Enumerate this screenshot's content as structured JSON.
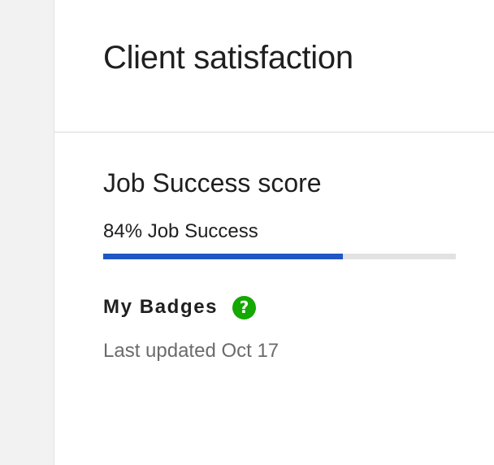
{
  "header": {
    "title": "Client satisfaction"
  },
  "job_success": {
    "title": "Job Success score",
    "score_label": "84% Job Success",
    "progress_percent": 68,
    "progress_color": "#1f57c3",
    "track_color": "#e2e2e2"
  },
  "badges": {
    "title": "My Badges",
    "help_icon": "question-circle-icon",
    "help_icon_color": "#14a800",
    "help_glyph": "?",
    "last_updated": "Last updated Oct 17"
  }
}
